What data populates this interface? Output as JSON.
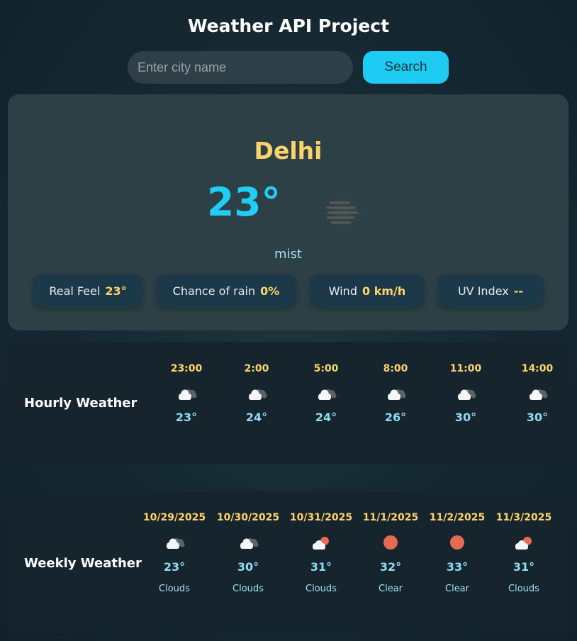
{
  "app": {
    "title": "Weather API Project"
  },
  "search": {
    "placeholder": "Enter city name",
    "value": "",
    "button_label": "Search"
  },
  "current": {
    "city": "Delhi",
    "temperature": "23°",
    "condition": "mist",
    "icon": "mist-icon",
    "stats": [
      {
        "label": "Real Feel",
        "value": "23°"
      },
      {
        "label": "Chance of rain",
        "value": "0%"
      },
      {
        "label": "Wind",
        "value": "0 km/h"
      },
      {
        "label": "UV Index",
        "value": "--"
      }
    ]
  },
  "hourly": {
    "title": "Hourly Weather",
    "items": [
      {
        "time": "23:00",
        "icon": "clouds-icon",
        "temp": "23°"
      },
      {
        "time": "2:00",
        "icon": "clouds-icon",
        "temp": "24°"
      },
      {
        "time": "5:00",
        "icon": "clouds-icon",
        "temp": "24°"
      },
      {
        "time": "8:00",
        "icon": "clouds-icon",
        "temp": "26°"
      },
      {
        "time": "11:00",
        "icon": "clouds-icon",
        "temp": "30°"
      },
      {
        "time": "14:00",
        "icon": "clouds-icon",
        "temp": "30°"
      }
    ]
  },
  "weekly": {
    "title": "Weekly Weather",
    "items": [
      {
        "date": "10/29/2025",
        "icon": "clouds-icon",
        "temp": "23°",
        "desc": "Clouds"
      },
      {
        "date": "10/30/2025",
        "icon": "clouds-icon",
        "temp": "30°",
        "desc": "Clouds"
      },
      {
        "date": "10/31/2025",
        "icon": "partly-cloudy-icon",
        "temp": "31°",
        "desc": "Clouds"
      },
      {
        "date": "11/1/2025",
        "icon": "sun-icon",
        "temp": "32°",
        "desc": "Clear"
      },
      {
        "date": "11/2/2025",
        "icon": "sun-icon",
        "temp": "33°",
        "desc": "Clear"
      },
      {
        "date": "11/3/2025",
        "icon": "partly-cloudy-icon",
        "temp": "31°",
        "desc": "Clouds"
      }
    ]
  },
  "colors": {
    "accent": "#1ecbf3",
    "city": "#ffd36b",
    "temperature": "#21cdf6",
    "sun": "#e86a4f"
  }
}
